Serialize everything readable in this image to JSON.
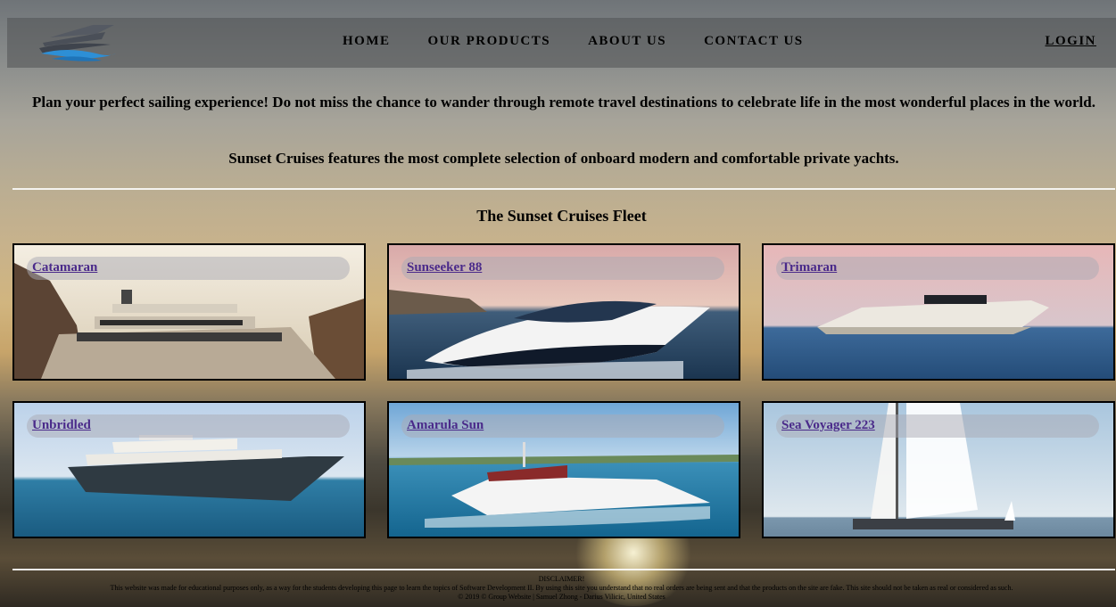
{
  "header": {
    "nav": [
      "HOME",
      "OUR PRODUCTS",
      "ABOUT US",
      "CONTACT US"
    ],
    "login": "LOGIN"
  },
  "intro": {
    "line1": "Plan your perfect sailing experience! Do not miss the chance to wander through remote travel destinations to celebrate life in the most wonderful places in the world.",
    "line2": "Sunset Cruises features the most complete selection of onboard modern and comfortable private yachts."
  },
  "fleet": {
    "title": "The Sunset Cruises Fleet",
    "items": [
      {
        "name": "Catamaran"
      },
      {
        "name": "Sunseeker 88"
      },
      {
        "name": "Trimaran"
      },
      {
        "name": "Unbridled"
      },
      {
        "name": "Amarula Sun"
      },
      {
        "name": "Sea Voyager 223"
      }
    ]
  },
  "footer": {
    "disclaimer_title": "DISCLAIMER!",
    "disclaimer_text": "This website was made for educational purposes only, as a way for the students developing this page to learn the topics of Software Development II. By using this site you understand that no real orders are being sent and that the products on the site are fake. This site should not be taken as real or considered as such.",
    "copyright": "© 2019 © Group Website | Samuel Zhong - Darius Vilicic, United States"
  }
}
